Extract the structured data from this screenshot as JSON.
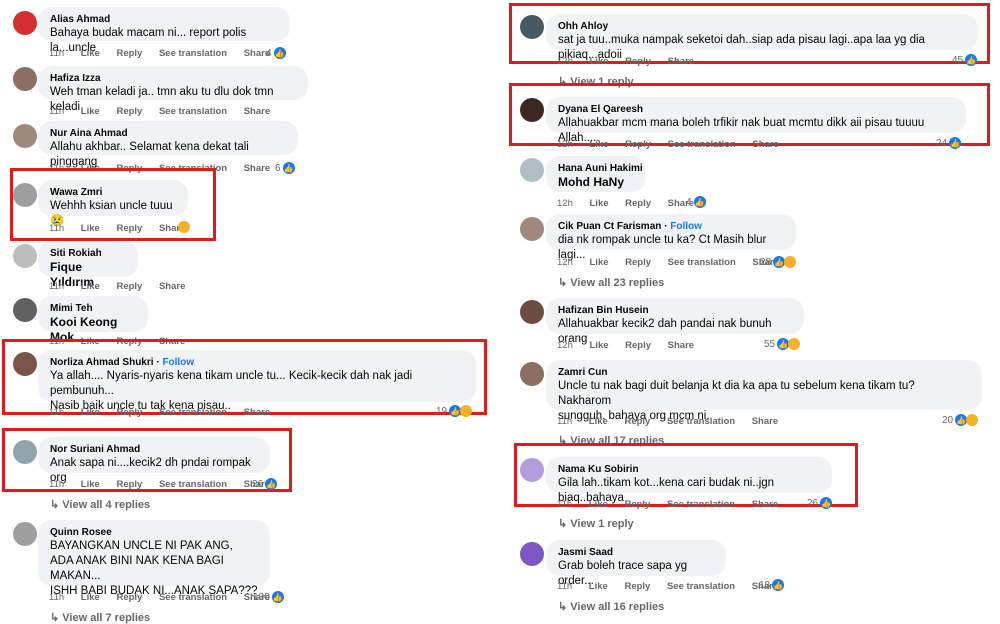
{
  "left": [
    {
      "author": "Alias Ahmad",
      "text": [
        "Bahaya budak macam ni... report polis la...uncle"
      ],
      "time": "11h",
      "actions": [
        "Like",
        "Reply",
        "See translation",
        "Share"
      ],
      "reactions": "4"
    },
    {
      "author": "Hafiza Izza",
      "text": [
        "Weh tman keladi ja.. tmn aku tu dlu dok tmn keladi"
      ],
      "time": "11h",
      "actions": [
        "Like",
        "Reply",
        "See translation",
        "Share"
      ],
      "reactions": ""
    },
    {
      "author": "Nur Aina Ahmad",
      "text": [
        "Allahu akhbar.. Selamat kena dekat tali pinggang"
      ],
      "time": "11h",
      "actions": [
        "Like",
        "Reply",
        "See translation",
        "Share"
      ],
      "reactions": "6"
    },
    {
      "author": "Wawa Zmri",
      "text": [
        "Wehhh ksian uncle tuuu"
      ],
      "time": "11h",
      "actions": [
        "Like",
        "Reply",
        "Share"
      ],
      "reactions": ""
    },
    {
      "author": "Siti Rokiah",
      "text": [
        "Fique Yıldırım"
      ],
      "time": "11h",
      "actions": [
        "Like",
        "Reply",
        "Share"
      ],
      "reactions": ""
    },
    {
      "author": "Mimi Teh",
      "text": [
        "Kooi Keong Mok"
      ],
      "time": "11h",
      "actions": [
        "Like",
        "Reply",
        "Share"
      ],
      "reactions": ""
    },
    {
      "author": "Norliza Ahmad Shukri",
      "follow": "Follow",
      "text": [
        "Ya allah.... Nyaris-nyaris kena tikam uncle tu... Kecik-kecik dah nak jadi pembunuh...",
        "Nasib baik uncle tu tak kena pisau.."
      ],
      "time": "11h",
      "actions": [
        "Like",
        "Reply",
        "See translation",
        "Share"
      ],
      "reactions": "19"
    },
    {
      "author": "Nor Suriani Ahmad",
      "text": [
        "Anak sapa ni....kecik2 dh pndai rompak org"
      ],
      "time": "11h",
      "actions": [
        "Like",
        "Reply",
        "See translation",
        "Share"
      ],
      "reactions": "26",
      "replies": "View all 4 replies"
    },
    {
      "author": "Quinn Rosee",
      "text": [
        "BAYANGKAN UNCLE NI PAK ANG,",
        "ADA ANAK BINI NAK KENA BAGI MAKAN...",
        "ISHH BABI BUDAK NI...ANAK SAPA???"
      ],
      "time": "11h",
      "actions": [
        "Like",
        "Reply",
        "See translation",
        "Share"
      ],
      "reactions": "130",
      "replies": "View all 7 replies"
    }
  ],
  "right": [
    {
      "author": "Ohh Ahloy",
      "text": [
        "sat ja tuu..muka nampak seketoi dah..siap ada pisau lagi..apa laa yg dia pikiaq...adoii"
      ],
      "time": "12h",
      "actions": [
        "Like",
        "Reply",
        "Share"
      ],
      "reactions": "45",
      "replies": "View 1 reply"
    },
    {
      "author": "Dyana El Qareesh",
      "text": [
        "Allahuakbar mcm mana boleh trfikir nak buat mcmtu dikk aii pisau tuuuu Allah....."
      ],
      "time": "12h",
      "actions": [
        "Like",
        "Reply",
        "See translation",
        "Share"
      ],
      "reactions": "24"
    },
    {
      "author": "Hana Auni Hakimi",
      "text": [
        "Mohd HaNy"
      ],
      "time": "12h",
      "actions": [
        "Like",
        "Reply",
        "Share"
      ],
      "reactions": "4"
    },
    {
      "author": "Cik Puan Ct Farisman",
      "follow": "Follow",
      "text": [
        "dia nk rompak uncle tu ka? Ct Masih blur lagi..."
      ],
      "time": "12h",
      "actions": [
        "Like",
        "Reply",
        "See translation",
        "Share"
      ],
      "reactions": "28",
      "replies": "View all 23 replies"
    },
    {
      "author": "Hafizan Bin Husein",
      "text": [
        "Allahuakbar kecik2 dah pandai nak bunuh orang"
      ],
      "time": "12h",
      "actions": [
        "Like",
        "Reply",
        "Share"
      ],
      "reactions": "55"
    },
    {
      "author": "Zamri Cun",
      "text": [
        "Uncle tu nak bagi duit belanja kt dia ka apa tu sebelum kena tikam tu? Nakharom",
        "sungguh, bahaya org mcm ni."
      ],
      "time": "11h",
      "actions": [
        "Like",
        "Reply",
        "See translation",
        "Share"
      ],
      "reactions": "20",
      "replies": "View all 17 replies"
    },
    {
      "author": "Nama Ku Sobirin",
      "text": [
        "Gila lah..tikam kot...kena cari budak ni..jgn biaq..bahaya"
      ],
      "time": "11h",
      "actions": [
        "Like",
        "Reply",
        "See translation",
        "Share"
      ],
      "reactions": "26",
      "replies": "View 1 reply"
    },
    {
      "author": "Jasmi Saad",
      "text": [
        "Grab boleh trace sapa yg order..."
      ],
      "time": "11h",
      "actions": [
        "Like",
        "Reply",
        "See translation",
        "Share"
      ],
      "reactions": "18",
      "replies": "View all 16 replies"
    }
  ],
  "colors": {
    "highlight": "#e01b1b",
    "link": "#1877f2",
    "bubble": "#f0f2f5",
    "muted": "#65676b"
  }
}
